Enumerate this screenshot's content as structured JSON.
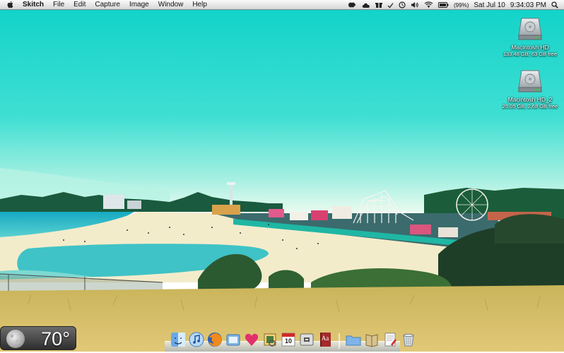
{
  "menubar": {
    "app_name": "Skitch",
    "menus": [
      "File",
      "Edit",
      "Capture",
      "Image",
      "Window",
      "Help"
    ],
    "battery": "(99%)",
    "date": "Sat Jul 10",
    "time": "9:34:03 PM",
    "status_icons": [
      "growl-icon",
      "cloud-icon",
      "gift-icon",
      "checkmark-icon",
      "time-machine-icon",
      "volume-icon",
      "wifi-icon",
      "battery-icon",
      "spotlight-icon"
    ]
  },
  "desktop": {
    "drives": [
      {
        "name": "Macintosh HD",
        "info": "133.48 GB, 63 GB free"
      },
      {
        "name": "Macintosh HD_2",
        "info": "26.05 GB, 2.68 GB free"
      }
    ]
  },
  "weather": {
    "temperature": "70°",
    "icon": "moon-icon"
  },
  "dock": {
    "calendar_day": "10",
    "dictionary_label": "Aa",
    "apps": [
      "finder",
      "itunes",
      "firefox",
      "window",
      "candybar",
      "preview",
      "calendar",
      "chess",
      "dictionary",
      "folder",
      "book",
      "textedit",
      "trash"
    ]
  },
  "colors": {
    "sky": "#1ed8cf",
    "sand": "#f4efcf",
    "grass": "#d7bf6a",
    "ocean": "#1bb3c4"
  }
}
